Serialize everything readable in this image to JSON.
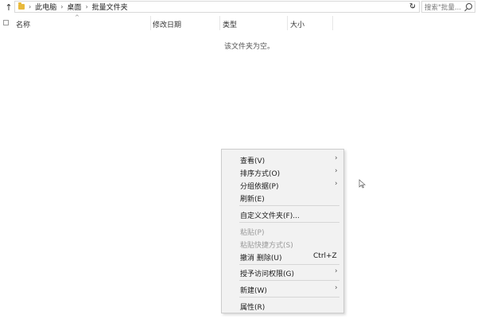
{
  "address_bar": {
    "breadcrumbs": [
      "此电脑",
      "桌面",
      "批量文件夹"
    ],
    "search_placeholder": "搜索\"批量..."
  },
  "columns": {
    "name": "名称",
    "date_modified": "修改日期",
    "type": "类型",
    "size": "大小"
  },
  "empty_message": "该文件夹为空。",
  "context_menu": {
    "items": [
      {
        "label": "查看(V)",
        "submenu": true,
        "disabled": false
      },
      {
        "label": "排序方式(O)",
        "submenu": true,
        "disabled": false
      },
      {
        "label": "分组依据(P)",
        "submenu": true,
        "disabled": false
      },
      {
        "label": "刷新(E)",
        "submenu": false,
        "disabled": false
      },
      {
        "label": "自定义文件夹(F)...",
        "submenu": false,
        "disabled": false
      },
      {
        "label": "粘贴(P)",
        "submenu": false,
        "disabled": true
      },
      {
        "label": "粘贴快捷方式(S)",
        "submenu": false,
        "disabled": true
      },
      {
        "label": "撤消 删除(U)",
        "shortcut": "Ctrl+Z",
        "submenu": false,
        "disabled": false
      },
      {
        "label": "授予访问权限(G)",
        "submenu": true,
        "disabled": false
      },
      {
        "label": "新建(W)",
        "submenu": true,
        "disabled": false
      },
      {
        "label": "属性(R)",
        "submenu": false,
        "disabled": false
      }
    ]
  },
  "icons": {
    "up": "up-arrow-icon",
    "folder": "folder-icon",
    "refresh": "refresh-icon",
    "search": "search-icon",
    "submenu": "chevron-right-icon"
  },
  "colors": {
    "menu_bg": "#f2f2f2",
    "disabled_text": "#9a9a9a",
    "folder": "#e8b93c"
  }
}
